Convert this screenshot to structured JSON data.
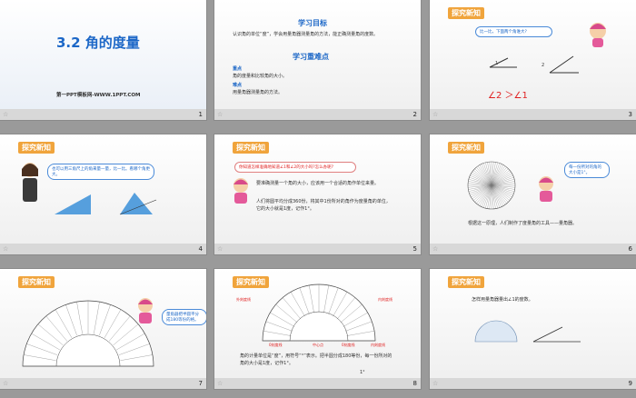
{
  "slides": [
    {
      "num": "1",
      "title": "3.2  角的度量",
      "footer": "第一PPT模板网-WWW.1PPT.COM"
    },
    {
      "num": "2",
      "goal_title": "学习目标",
      "goal_text": "认识角的单位“度”，学会用量角器测量角的方法，能正确测量角的度数。",
      "key_title": "学习重难点",
      "key_label": "重点",
      "key_text": "角的度量和比较角的大小。",
      "hard_label": "难点",
      "hard_text": "用量角器测量角的方法。"
    },
    {
      "num": "3",
      "tag": "探究新知",
      "bubble": "比一比，下面两个角谁大?",
      "label1": "1",
      "label2": "2",
      "compare": "∠2 ＞∠1"
    },
    {
      "num": "4",
      "tag": "探究新知",
      "bubble": "也可以用三角尺上的角来量一量，比一比。看哪个角更大。"
    },
    {
      "num": "5",
      "tag": "探究新知",
      "bubble": "你知道怎样准确地知道∠1和∠2的大小吗?怎么办呢?",
      "text1": "要准确测量一个角的大小，应该用一个合适的角作单位来量。",
      "text2": "人们将圆平均分成360份，将其中1份所对的角作为度量角的单位，它的大小就是1度，记作1°。"
    },
    {
      "num": "6",
      "tag": "探究新知",
      "bubble": "每一份所对的角的大小是1°。",
      "text": "根据这一原理，人们制作了度量角的工具——量角器。"
    },
    {
      "num": "7",
      "tag": "探究新知",
      "bubble": "量角器把半圆平分成180等份的格。"
    },
    {
      "num": "8",
      "tag": "探究新知",
      "labels": [
        "外刻度线",
        "内刻度线",
        "0刻度线",
        "中心点",
        "0刻度线",
        "内刻度线"
      ],
      "text": "角的计量单位是“度”，用符号“°”表示。把半圆分成180等份，每一份所对的角的大小是1度，记作1°。",
      "deg": "1°"
    },
    {
      "num": "9",
      "tag": "探究新知",
      "text": "怎样用量角器量出∠1的度数。"
    }
  ],
  "colors": {
    "accent": "#f0a43c",
    "blue": "#1c67c7",
    "red": "#e02020"
  }
}
